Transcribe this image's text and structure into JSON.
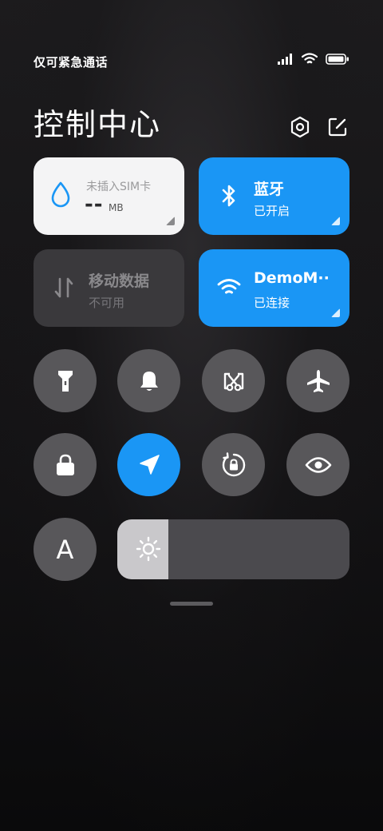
{
  "status": {
    "carrier_text": "仅可紧急通话"
  },
  "header": {
    "title": "控制中心"
  },
  "tiles": {
    "data": {
      "label": "未插入SIM卡",
      "value": "--",
      "unit": "MB"
    },
    "bluetooth": {
      "title": "蓝牙",
      "status": "已开启"
    },
    "mobile_data": {
      "title": "移动数据",
      "status": "不可用"
    },
    "wifi": {
      "title": "DemoM··",
      "status": "已连接"
    }
  },
  "buttons": {
    "auto_brightness_label": "A"
  },
  "brightness": {
    "level": 0.22
  },
  "colors": {
    "accent": "#1a96f5",
    "button": "#58575a",
    "tile_off": "#3a393c"
  }
}
